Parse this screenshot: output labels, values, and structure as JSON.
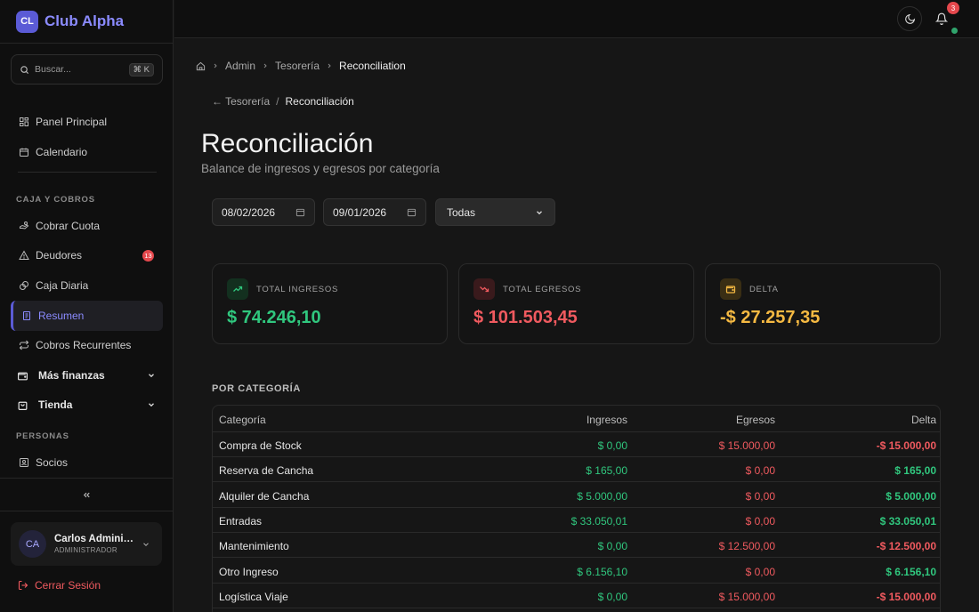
{
  "brand": {
    "initials": "CL",
    "name": "Club Alpha"
  },
  "search": {
    "placeholder": "Buscar...",
    "shortcut": "⌘ K"
  },
  "nav": {
    "panel": "Panel Principal",
    "calendar": "Calendario",
    "section_caja": "CAJA Y COBROS",
    "cobrar": "Cobrar Cuota",
    "deudores": "Deudores",
    "deudores_count": "13",
    "caja_diaria": "Caja Diaria",
    "resumen": "Resumen",
    "recurrentes": "Cobros Recurrentes",
    "mas_finanzas": "Más finanzas",
    "tienda": "Tienda",
    "section_personas": "PERSONAS",
    "socios": "Socios"
  },
  "user": {
    "initials": "CA",
    "name": "Carlos Administrador",
    "role": "ADMINISTRADOR"
  },
  "logout_label": "Cerrar Sesión",
  "topbar": {
    "notifications_count": "3"
  },
  "breadcrumb": {
    "a": "Admin",
    "b": "Tesorería",
    "c": "Reconciliation"
  },
  "backlink": {
    "label": "← Tesorería",
    "sep": "/",
    "current": "Reconciliación"
  },
  "page": {
    "title": "Reconciliación",
    "subtitle": "Balance de ingresos y egresos por categoría"
  },
  "filters": {
    "date_from": "08/02/2026",
    "date_to": "09/01/2026",
    "select_value": "Todas"
  },
  "summary": {
    "ingresos_label": "TOTAL INGRESOS",
    "ingresos_value": "$ 74.246,10",
    "egresos_label": "TOTAL EGRESOS",
    "egresos_value": "$ 101.503,45",
    "delta_label": "DELTA",
    "delta_value": "-$ 27.257,35"
  },
  "colors": {
    "accent": "#5b5bd6",
    "positive": "#30c77e",
    "negative": "#f05a5f",
    "warning": "#f5b942"
  },
  "table": {
    "heading": "POR CATEGORÍA",
    "columns": [
      "Categoría",
      "Ingresos",
      "Egresos",
      "Delta"
    ],
    "rows": [
      [
        "Compra de Stock",
        "$ 0,00",
        "$ 15.000,00",
        "-$ 15.000,00"
      ],
      [
        "Reserva de Cancha",
        "$ 165,00",
        "$ 0,00",
        "$ 165,00"
      ],
      [
        "Alquiler de Cancha",
        "$ 5.000,00",
        "$ 0,00",
        "$ 5.000,00"
      ],
      [
        "Entradas",
        "$ 33.050,01",
        "$ 0,00",
        "$ 33.050,01"
      ],
      [
        "Mantenimiento",
        "$ 0,00",
        "$ 12.500,00",
        "-$ 12.500,00"
      ],
      [
        "Otro Ingreso",
        "$ 6.156,10",
        "$ 0,00",
        "$ 6.156,10"
      ],
      [
        "Logística Viaje",
        "$ 0,00",
        "$ 15.000,00",
        "-$ 15.000,00"
      ]
    ]
  }
}
